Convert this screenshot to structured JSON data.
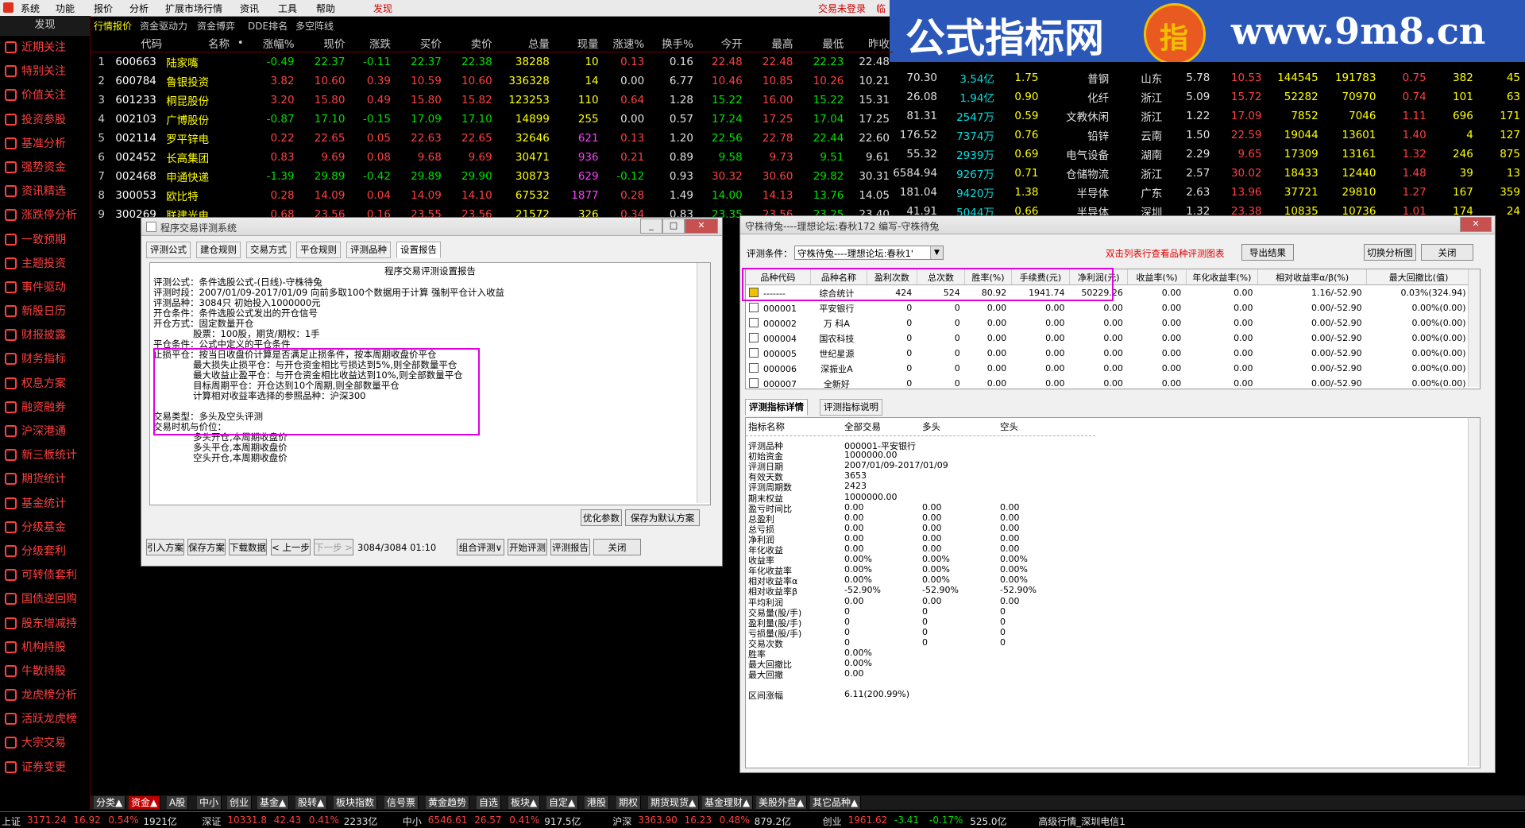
{
  "menu": [
    "系统",
    "功能",
    "报价",
    "分析",
    "扩展市场行情",
    "资讯",
    "工具",
    "帮助",
    "发现"
  ],
  "top_status": "交易未登录",
  "top_status2": "临",
  "banner": {
    "brand": "公式指标网",
    "seal_char": "指",
    "url": "www.9m8.cn"
  },
  "sidebar": {
    "header": "发现",
    "items": [
      {
        "label": "近期关注",
        "icon": "star-icon"
      },
      {
        "label": "特别关注",
        "icon": "eye-icon"
      },
      {
        "label": "价值关注",
        "icon": "diamond-icon"
      },
      {
        "label": "投资参股",
        "icon": "person-icon"
      },
      {
        "label": "基准分析",
        "icon": "chart-icon"
      },
      {
        "label": "强势资金",
        "icon": "money-icon"
      },
      {
        "label": "资讯精选",
        "icon": "news-icon"
      },
      {
        "label": "涨跌停分析",
        "icon": "arrows-icon"
      },
      {
        "label": "一致预期",
        "icon": "line-chart-icon"
      },
      {
        "label": "主题投资",
        "icon": "target-icon"
      },
      {
        "label": "事件驱动",
        "icon": "lightning-icon"
      },
      {
        "label": "新股日历",
        "icon": "calendar-icon"
      },
      {
        "label": "财报披露",
        "icon": "report-icon"
      },
      {
        "label": "财务指标",
        "icon": "finance-icon"
      },
      {
        "label": "权息方案",
        "icon": "dividend-icon"
      },
      {
        "label": "融资融券",
        "icon": "margin-icon"
      },
      {
        "label": "沪深港通",
        "icon": "connect-icon"
      },
      {
        "label": "新三板统计",
        "icon": "stats-icon"
      },
      {
        "label": "期货统计",
        "icon": "futures-icon"
      },
      {
        "label": "基金统计",
        "icon": "fund-icon"
      },
      {
        "label": "分级基金",
        "icon": "tier-icon"
      },
      {
        "label": "分级套利",
        "icon": "arbitrage-icon"
      },
      {
        "label": "可转债套利",
        "icon": "bond-icon"
      },
      {
        "label": "国债逆回购",
        "icon": "repo-icon"
      },
      {
        "label": "股东增减持",
        "icon": "holder-icon"
      },
      {
        "label": "机构持股",
        "icon": "institution-icon"
      },
      {
        "label": "牛散持股",
        "icon": "bull-icon"
      },
      {
        "label": "龙虎榜分析",
        "icon": "dragon-icon"
      },
      {
        "label": "活跃龙虎榜",
        "icon": "active-icon"
      },
      {
        "label": "大宗交易",
        "icon": "block-trade-icon"
      },
      {
        "label": "证券变更",
        "icon": "change-icon"
      }
    ]
  },
  "top_tabs": [
    "行情报价",
    "资金驱动力",
    "资金博弈",
    "DDE排名",
    "多空阵线"
  ],
  "quote_table": {
    "headers": [
      "",
      "代码",
      "名称",
      "•",
      "涨幅%",
      "现价",
      "涨跌",
      "买价",
      "卖价",
      "总量",
      "现量",
      "涨速%",
      "换手%",
      "今开",
      "最高",
      "最低",
      "昨收"
    ],
    "rows": [
      [
        "1",
        "600663",
        "陆家嘴",
        "-0.49",
        "22.37",
        "-0.11",
        "22.37",
        "22.38",
        "38288",
        "10",
        "0.13",
        "0.16",
        "22.48",
        "22.48",
        "22.23",
        "22.48"
      ],
      [
        "2",
        "600784",
        "鲁银投资",
        "3.82",
        "10.60",
        "0.39",
        "10.59",
        "10.60",
        "336328",
        "14",
        "0.00",
        "6.77",
        "10.46",
        "10.85",
        "10.26",
        "10.21"
      ],
      [
        "3",
        "601233",
        "桐昆股份",
        "3.20",
        "15.80",
        "0.49",
        "15.80",
        "15.82",
        "123253",
        "110",
        "0.64",
        "1.28",
        "15.22",
        "16.00",
        "15.22",
        "15.31"
      ],
      [
        "4",
        "002103",
        "广博股份",
        "-0.87",
        "17.10",
        "-0.15",
        "17.09",
        "17.10",
        "14899",
        "255",
        "0.00",
        "0.57",
        "17.24",
        "17.25",
        "17.04",
        "17.25"
      ],
      [
        "5",
        "002114",
        "罗平锌电",
        "0.22",
        "22.65",
        "0.05",
        "22.63",
        "22.65",
        "32646",
        "621",
        "0.13",
        "1.20",
        "22.56",
        "22.78",
        "22.44",
        "22.60"
      ],
      [
        "6",
        "002452",
        "长高集团",
        "0.83",
        "9.69",
        "0.08",
        "9.68",
        "9.69",
        "30471",
        "936",
        "0.21",
        "0.89",
        "9.58",
        "9.73",
        "9.51",
        "9.61"
      ],
      [
        "7",
        "002468",
        "申通快递",
        "-1.39",
        "29.89",
        "-0.42",
        "29.89",
        "29.90",
        "30873",
        "629",
        "-0.12",
        "0.93",
        "30.32",
        "30.60",
        "29.82",
        "30.31"
      ],
      [
        "8",
        "300053",
        "欧比特",
        "0.28",
        "14.09",
        "0.04",
        "14.09",
        "14.10",
        "67532",
        "1877",
        "0.28",
        "1.49",
        "14.00",
        "14.13",
        "13.76",
        "14.05"
      ],
      [
        "9",
        "300269",
        "联建光电",
        "0.68",
        "23.56",
        "0.16",
        "23.55",
        "23.56",
        "21572",
        "326",
        "0.34",
        "0.83",
        "23.35",
        "23.56",
        "23.25",
        "23.40"
      ]
    ]
  },
  "right_table": {
    "rows": [
      [
        "70.30",
        "3.54亿",
        "1.75",
        "普钢",
        "山东",
        "5.78",
        "10.53",
        "144545",
        "191783",
        "0.75",
        "382",
        "45"
      ],
      [
        "26.08",
        "1.94亿",
        "0.90",
        "化纤",
        "浙江",
        "5.09",
        "15.72",
        "52282",
        "70970",
        "0.74",
        "101",
        "63"
      ],
      [
        "81.31",
        "2547万",
        "0.59",
        "文教休闲",
        "浙江",
        "1.22",
        "17.09",
        "7852",
        "7046",
        "1.11",
        "696",
        "171"
      ],
      [
        "176.52",
        "7374万",
        "0.76",
        "铅锌",
        "云南",
        "1.50",
        "22.59",
        "19044",
        "13601",
        "1.40",
        "4",
        "127"
      ],
      [
        "55.32",
        "2939万",
        "0.69",
        "电气设备",
        "湖南",
        "2.29",
        "9.65",
        "17309",
        "13161",
        "1.32",
        "246",
        "875"
      ],
      [
        "6584.94",
        "9267万",
        "0.71",
        "仓储物流",
        "浙江",
        "2.57",
        "30.02",
        "18433",
        "12440",
        "1.48",
        "39",
        "13"
      ],
      [
        "181.04",
        "9420万",
        "1.38",
        "半导体",
        "广东",
        "2.63",
        "13.96",
        "37721",
        "29810",
        "1.27",
        "167",
        "359"
      ],
      [
        "41.91",
        "5044万",
        "0.66",
        "半导体",
        "深圳",
        "1.32",
        "23.38",
        "10835",
        "10736",
        "1.01",
        "174",
        "24"
      ]
    ]
  },
  "win1": {
    "title": "程序交易评测系统",
    "tabs": [
      "评测公式",
      "建仓规则",
      "交易方式",
      "平仓规则",
      "评测品种",
      "设置报告"
    ],
    "report_title": "程序交易评测设置报告",
    "lines": [
      "评测公式：条件选股公式-(日线)-守株待兔",
      "评测时段：2007/01/09-2017/01/09 向前多取100个数据用于计算 强制平仓计入收益",
      "评测品种：3084只 初始投入1000000元",
      "开仓条件：条件选股公式发出的开仓信号",
      "开仓方式：固定数量开仓",
      "股票：100股，期货/期权：1手",
      "平仓条件：公式中定义的平仓条件",
      "止损平仓：按当日收盘价计算是否满足止损条件，按本周期收盘价平仓",
      "最大损失止损平仓：与开仓资金相比亏损达到5%,则全部数量平仓",
      "最大收益止盈平仓：与开仓资金相比收益达到10%,则全部数量平仓",
      "目标周期平仓：开仓达到10个周期,则全部数量平仓",
      "计算相对收益率选择的参照品种：沪深300",
      "交易类型：多头及空头评测",
      "交易时机与价位：",
      "多头开仓,本周期收盘价",
      "多头平仓,本周期收盘价",
      "空头开仓,本周期收盘价"
    ],
    "btn_optimize": "优化参数",
    "btn_save_default": "保存为默认方案",
    "btn_import": "引入方案",
    "btn_save": "保存方案",
    "btn_download": "下载数据",
    "btn_prev": "< 上一步",
    "btn_next": "下一步 >",
    "progress_text": "3084/3084 01:10",
    "btn_combo": "组合评测∨",
    "btn_start": "开始评测",
    "btn_report": "评测报告",
    "btn_close": "关闭"
  },
  "win2": {
    "title": "守株待兔----理想论坛:春秋172 编写-守株待兔",
    "cond_label": "评测条件：",
    "cond_value": "守株待兔----理想论坛:春秋1'",
    "hint": "双击列表行查看品种评测图表",
    "btn_export": "导出结果",
    "btn_switch": "切换分析图",
    "btn_close": "关闭",
    "grid_headers": [
      "品种代码",
      "品种名称",
      "盈利次数",
      "总次数",
      "胜率(%)",
      "手续费(元)",
      "净利润(元)",
      "收益率(%)",
      "年化收益率(%)",
      "相对收益率α/β(%)",
      "最大回撤比(值)"
    ],
    "grid_rows": [
      [
        "-------",
        "综合统计",
        "424",
        "524",
        "80.92",
        "1941.74",
        "50229.26",
        "0.00",
        "0.00",
        "1.16/-52.90",
        "0.03%(324.94)"
      ],
      [
        "000001",
        "平安银行",
        "0",
        "0",
        "0.00",
        "0.00",
        "0.00",
        "0.00",
        "0.00",
        "0.00/-52.90",
        "0.00%(0.00)"
      ],
      [
        "000002",
        "万 科A",
        "0",
        "0",
        "0.00",
        "0.00",
        "0.00",
        "0.00",
        "0.00",
        "0.00/-52.90",
        "0.00%(0.00)"
      ],
      [
        "000004",
        "国农科技",
        "0",
        "0",
        "0.00",
        "0.00",
        "0.00",
        "0.00",
        "0.00",
        "0.00/-52.90",
        "0.00%(0.00)"
      ],
      [
        "000005",
        "世纪星源",
        "0",
        "0",
        "0.00",
        "0.00",
        "0.00",
        "0.00",
        "0.00",
        "0.00/-52.90",
        "0.00%(0.00)"
      ],
      [
        "000006",
        "深振业A",
        "0",
        "0",
        "0.00",
        "0.00",
        "0.00",
        "0.00",
        "0.00",
        "0.00/-52.90",
        "0.00%(0.00)"
      ],
      [
        "000007",
        "全新好",
        "0",
        "0",
        "0.00",
        "0.00",
        "0.00",
        "0.00",
        "0.00",
        "0.00/-52.90",
        "0.00%(0.00)"
      ],
      [
        "000008",
        "神州高铁",
        "0",
        "0",
        "0.00",
        "0.00",
        "0.00",
        "0.00",
        "0.00",
        "0.00/-52.90",
        "0.00%(0.00)"
      ]
    ],
    "detail_tabs": [
      "评测指标详情",
      "评测指标说明"
    ],
    "detail_headers": [
      "指标名称",
      "全部交易",
      "多头",
      "空头"
    ],
    "detail_rows": [
      [
        "评测品种",
        "000001-平安银行",
        "",
        ""
      ],
      [
        "初始资金",
        "1000000.00",
        "",
        ""
      ],
      [
        "评测日期",
        "2007/01/09-2017/01/09",
        "",
        ""
      ],
      [
        "有效天数",
        "3653",
        "",
        ""
      ],
      [
        "评测周期数",
        "2423",
        "",
        ""
      ],
      [
        "期末权益",
        "1000000.00",
        "",
        ""
      ],
      [
        "盈亏时间比",
        "0.00",
        "0.00",
        "0.00"
      ],
      [
        "总盈利",
        "0.00",
        "0.00",
        "0.00"
      ],
      [
        "总亏损",
        "0.00",
        "0.00",
        "0.00"
      ],
      [
        "净利润",
        "0.00",
        "0.00",
        "0.00"
      ],
      [
        "年化收益",
        "0.00",
        "0.00",
        "0.00"
      ],
      [
        "收益率",
        "0.00%",
        "0.00%",
        "0.00%"
      ],
      [
        "年化收益率",
        "0.00%",
        "0.00%",
        "0.00%"
      ],
      [
        "相对收益率α",
        "0.00%",
        "0.00%",
        "0.00%"
      ],
      [
        "相对收益率β",
        "-52.90%",
        "-52.90%",
        "-52.90%"
      ],
      [
        "平均利润",
        "0.00",
        "0.00",
        "0.00"
      ],
      [
        "交易量(股/手)",
        "0",
        "0",
        "0"
      ],
      [
        "盈利量(股/手)",
        "0",
        "0",
        "0"
      ],
      [
        "亏损量(股/手)",
        "0",
        "0",
        "0"
      ],
      [
        "交易次数",
        "0",
        "0",
        "0"
      ],
      [
        "胜率",
        "0.00%",
        "",
        ""
      ],
      [
        "最大回撤比",
        "0.00%",
        "",
        ""
      ],
      [
        "最大回撤",
        "0.00",
        "",
        ""
      ],
      [
        "",
        "",
        "",
        ""
      ],
      [
        "区间涨幅",
        "6.11(200.99%)",
        "",
        ""
      ]
    ]
  },
  "bottom_tabs": [
    "分类▲",
    "资金▲",
    "A股",
    "中小",
    "创业",
    "基金▲",
    "股转▲",
    "板块指数",
    "信号票",
    "黄金趋势",
    "自选",
    "板块▲",
    "自定▲",
    "港股",
    "期权",
    "期货现货▲",
    "基金理财▲",
    "美股外盘▲",
    "其它品种▲"
  ],
  "statusbar": [
    {
      "t": "上证",
      "c": "wh"
    },
    {
      "t": "3171.24",
      "c": "up"
    },
    {
      "t": "16.92",
      "c": "up"
    },
    {
      "t": "0.54%",
      "c": "up"
    },
    {
      "t": "1921亿",
      "c": "wh"
    },
    {
      "t": "深证",
      "c": "wh"
    },
    {
      "t": "10331.8",
      "c": "up"
    },
    {
      "t": "42.43",
      "c": "up"
    },
    {
      "t": "0.41%",
      "c": "up"
    },
    {
      "t": "2233亿",
      "c": "wh"
    },
    {
      "t": "中小",
      "c": "wh"
    },
    {
      "t": "6546.61",
      "c": "up"
    },
    {
      "t": "26.57",
      "c": "up"
    },
    {
      "t": "0.41%",
      "c": "up"
    },
    {
      "t": "917.5亿",
      "c": "wh"
    },
    {
      "t": "沪深",
      "c": "wh"
    },
    {
      "t": "3363.90",
      "c": "up"
    },
    {
      "t": "16.23",
      "c": "up"
    },
    {
      "t": "0.48%",
      "c": "up"
    },
    {
      "t": "879.2亿",
      "c": "wh"
    },
    {
      "t": "创业",
      "c": "wh"
    },
    {
      "t": "1961.62",
      "c": "up"
    },
    {
      "t": "-3.41",
      "c": "dn"
    },
    {
      "t": "-0.17%",
      "c": "dn"
    },
    {
      "t": "525.0亿",
      "c": "wh"
    },
    {
      "t": "高级行情_深圳电信1",
      "c": "wh"
    }
  ]
}
